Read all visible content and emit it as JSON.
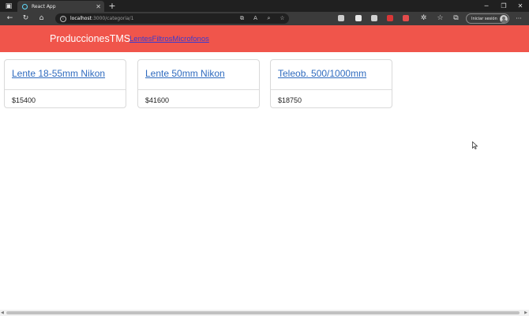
{
  "browser": {
    "tab_title": "React App",
    "tab_close": "✕",
    "new_tab": "+",
    "address_host": "localhost",
    "address_path": ":3000/categoria/1",
    "signin_label": "Iniciar sesión"
  },
  "header": {
    "brand": "ProduccionesTMS",
    "nav_links": [
      "Lentes",
      "Filtros",
      "Microfonos"
    ]
  },
  "products": [
    {
      "name": "Lente 18-55mm Nikon",
      "price": "$15400"
    },
    {
      "name": "Lente 50mm Nikon",
      "price": "$41600"
    },
    {
      "name": "Teleob. 500/1000mm",
      "price": "$18750"
    }
  ],
  "colors": {
    "header_bg": "#f0554b",
    "link": "#2f6bbf"
  }
}
